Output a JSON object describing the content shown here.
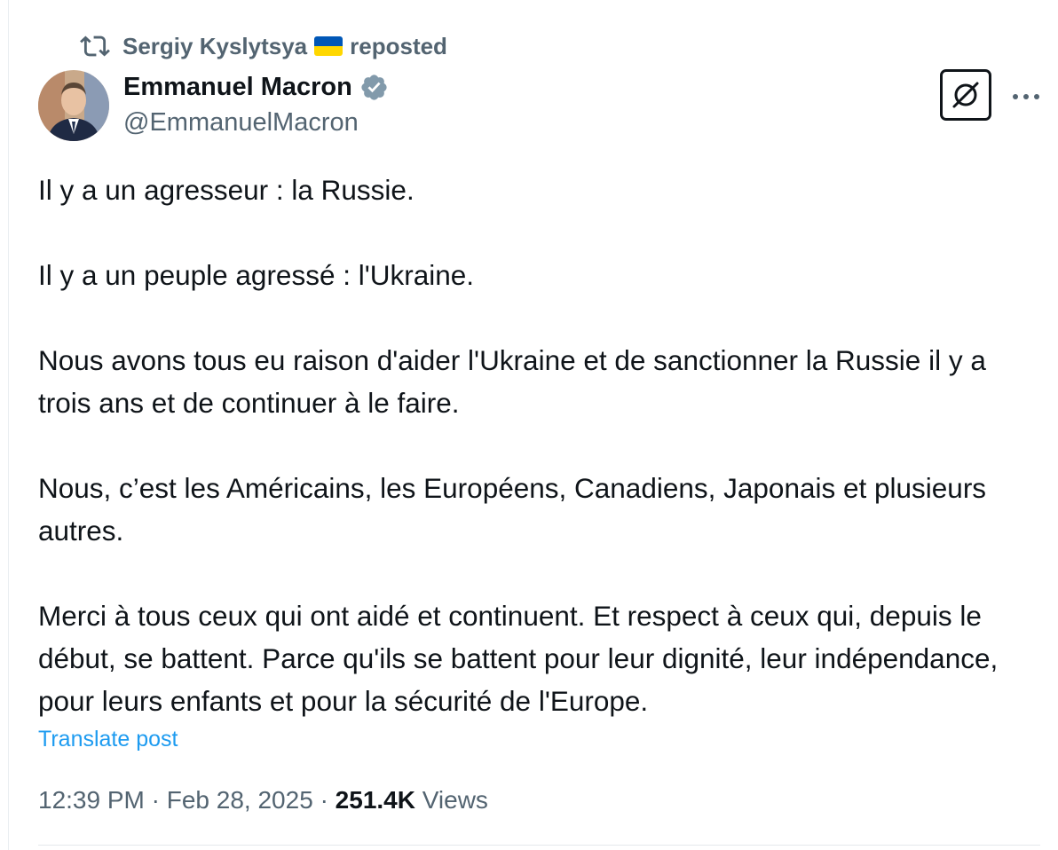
{
  "repost": {
    "reposter_name": "Sergiy Kyslytsya",
    "flag_icon": "ukraine-flag-icon",
    "label": "reposted"
  },
  "author": {
    "name": "Emmanuel Macron",
    "handle": "@EmmanuelMacron",
    "verified_icon": "verified-badge-icon",
    "verified_color": "#829aab"
  },
  "actions": {
    "grok_icon": "grok-icon",
    "more_icon": "more-options-icon"
  },
  "tweet": {
    "paragraphs": [
      "Il y a un agresseur : la Russie.",
      "Il y a un peuple agressé : l'Ukraine.",
      "Nous avons tous eu raison d'aider l'Ukraine et de sanctionner la Russie il y a trois ans et de continuer à le faire.",
      "Nous, c’est les Américains, les Européens, Canadiens, Japonais et plusieurs autres.",
      "Merci à tous ceux qui ont aidé et continuent. Et respect à ceux qui, depuis le début, se battent. Parce qu'ils se battent pour leur dignité, leur indépendance, pour leurs enfants et pour la sécurité de l'Europe."
    ],
    "translate_label": "Translate post"
  },
  "meta": {
    "time": "12:39 PM",
    "separator": "·",
    "date": "Feb 28, 2025",
    "views_count": "251.4K",
    "views_label": "Views"
  },
  "colors": {
    "text_primary": "#0f1419",
    "text_secondary": "#536471",
    "link": "#1d9bf0"
  }
}
